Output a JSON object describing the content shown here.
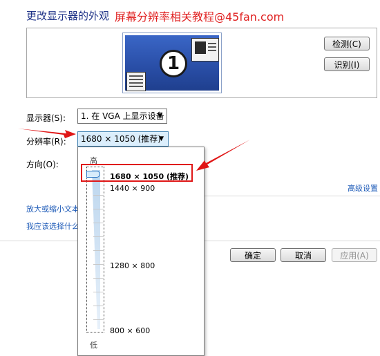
{
  "header": {
    "title": "更改显示器的外观",
    "watermark": "屏幕分辨率相关教程@45fan.com"
  },
  "preview": {
    "monitor_number": "1",
    "detect_label": "检测(C)",
    "identify_label": "识别(I)"
  },
  "settings": {
    "display_label": "显示器(S):",
    "display_value": "1. 在 VGA 上显示设备",
    "resolution_label": "分辨率(R):",
    "resolution_value": "1680 × 1050 (推荐)",
    "orientation_label": "方向(O):"
  },
  "links": {
    "advanced": "高级设置",
    "text_size": "放大或缩小文本",
    "help": "我应该选择什么"
  },
  "buttons": {
    "ok": "确定",
    "cancel": "取消",
    "apply": "应用(A)"
  },
  "resolution_dropdown": {
    "high_label": "高",
    "low_label": "低",
    "selected_index": 0,
    "options": [
      {
        "label": "1680 × 1050 (推荐)",
        "selected": true
      },
      {
        "label": "1440 × 900",
        "selected": false
      },
      {
        "label": "1280 × 800",
        "selected": false
      },
      {
        "label": "800 × 600",
        "selected": false
      }
    ]
  },
  "annotation": {
    "arrow_color": "#e01616",
    "highlight_color": "#e01616"
  }
}
